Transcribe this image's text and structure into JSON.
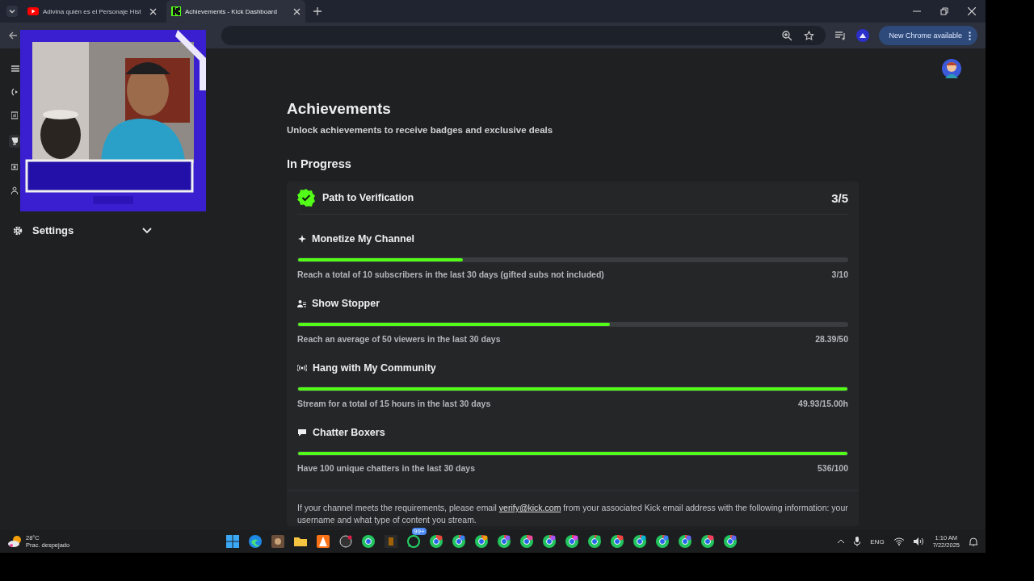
{
  "browser": {
    "tabs": [
      {
        "title": "Adivina quién es el Personaje Hist",
        "kind": "video",
        "selected": false
      },
      {
        "title": "Achievements - Kick Dashboard",
        "kind": "kick",
        "selected": true
      }
    ],
    "update_button": "New Chrome available"
  },
  "sidebar": {
    "settings": {
      "label": "Settings",
      "expanded": false
    }
  },
  "page": {
    "title": "Achievements",
    "subtitle": "Unlock achievements to receive badges and exclusive deals",
    "section": "In Progress",
    "card": {
      "title": "Path to Verification",
      "count": "3/5",
      "achievements": [
        {
          "kind": "sparkle",
          "title": "Monetize My Channel",
          "description": "Reach a total of 10 subscribers in the last 30 days (gifted subs not included)",
          "reading": "3/10",
          "level": 0.3
        },
        {
          "kind": "people",
          "title": "Show Stopper",
          "description": "Reach an average of 50 viewers in the last 30 days",
          "reading": "28.39/50",
          "level": 0.568
        },
        {
          "kind": "broadcast",
          "title": "Hang with My Community",
          "description": "Stream for a total of 15 hours in the last 30 days",
          "reading": "49.93/15.00h",
          "level": 1
        },
        {
          "kind": "chat",
          "title": "Chatter Boxers",
          "description": "Have 100 unique chatters in the last 30 days",
          "reading": "536/100",
          "level": 1
        }
      ],
      "footer_before": "If your channel meets the requirements, please email",
      "footer_link": "verify@kick.com",
      "footer_after": "from your associated Kick email address with the following information: your username and what type of content you stream."
    }
  },
  "taskbar": {
    "temperature": "28°C",
    "weather": "Prac. despejado",
    "badge": "99+",
    "language": "ENG",
    "time": "1:10 AM",
    "date": "7/22/2025"
  }
}
